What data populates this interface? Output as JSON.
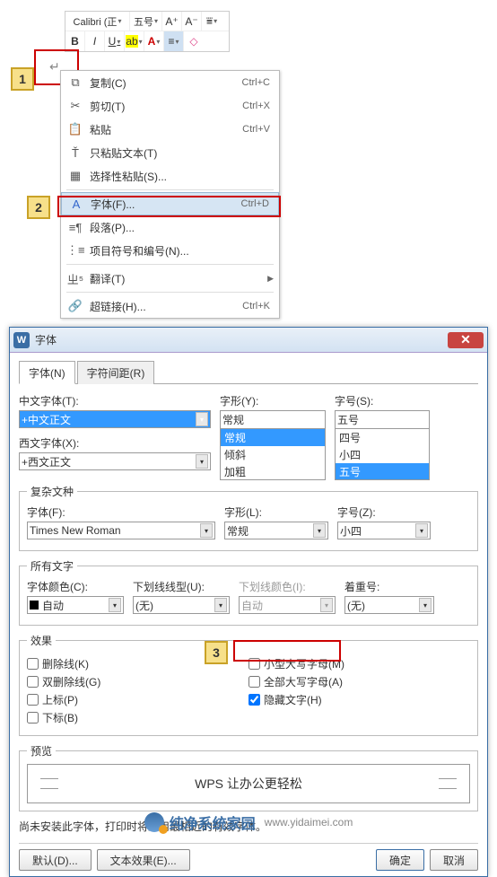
{
  "mini_toolbar": {
    "font_name": "Calibri (正",
    "font_size": "五号",
    "btn_inc": "A⁺",
    "btn_dec": "A⁻",
    "btn_linespace": "⩸",
    "b": "B",
    "i": "I",
    "u": "U",
    "hl": "ab",
    "color": "A",
    "align": "≡",
    "eraser": "◇"
  },
  "context_menu": {
    "items": [
      {
        "icon": "⧉",
        "label": "复制(C)",
        "shortcut": "Ctrl+C"
      },
      {
        "icon": "✂",
        "label": "剪切(T)",
        "shortcut": "Ctrl+X"
      },
      {
        "icon": "📋",
        "label": "粘贴",
        "shortcut": "Ctrl+V"
      },
      {
        "icon": "Ť",
        "label": "只粘贴文本(T)",
        "shortcut": ""
      },
      {
        "icon": "▦",
        "label": "选择性粘贴(S)...",
        "shortcut": ""
      },
      {
        "icon": "A",
        "label": "字体(F)...",
        "shortcut": "Ctrl+D",
        "hl": true
      },
      {
        "icon": "≡¶",
        "label": "段落(P)...",
        "shortcut": ""
      },
      {
        "icon": "⋮≡",
        "label": "项目符号和编号(N)...",
        "shortcut": ""
      },
      {
        "icon": "ㄓ⁵",
        "label": "翻译(T)",
        "shortcut": "",
        "submenu": true
      },
      {
        "icon": "🔗",
        "label": "超链接(H)...",
        "shortcut": "Ctrl+K"
      }
    ]
  },
  "dialog": {
    "title": "字体",
    "tabs": {
      "font": "字体(N)",
      "spacing": "字符间距(R)"
    },
    "labels": {
      "cn_font": "中文字体(T):",
      "en_font": "西文字体(X):",
      "style": "字形(Y):",
      "size": "字号(S):",
      "complex_section": "复杂文种",
      "complex_font": "字体(F):",
      "complex_style": "字形(L):",
      "complex_size": "字号(Z):",
      "all_text": "所有文字",
      "font_color": "字体颜色(C):",
      "underline": "下划线线型(U):",
      "underline_color": "下划线颜色(I):",
      "emphasis": "着重号:",
      "effects": "效果",
      "preview": "预览"
    },
    "values": {
      "cn_font_val": "+中文正文",
      "en_font_val": "+西文正文",
      "style_val": "常规",
      "style_opts": [
        "常规",
        "倾斜",
        "加粗"
      ],
      "size_val": "五号",
      "size_opts": [
        "四号",
        "小四",
        "五号"
      ],
      "complex_font_val": "Times New Roman",
      "complex_style_val": "常规",
      "complex_size_val": "小四",
      "font_color_val": "自动",
      "underline_val": "(无)",
      "underline_color_val": "自动",
      "emphasis_val": "(无)"
    },
    "effects": {
      "strike": "删除线(K)",
      "dstrike": "双删除线(G)",
      "sup": "上标(P)",
      "sub": "下标(B)",
      "smallcaps": "小型大写字母(M)",
      "allcaps": "全部大写字母(A)",
      "hidden": "隐藏文字(H)"
    },
    "preview_text": "WPS 让办公更轻松",
    "note": "尚未安装此字体，打印时将采用最相近的有效字体。",
    "buttons": {
      "default": "默认(D)...",
      "text_effects": "文本效果(E)...",
      "ok": "确定",
      "cancel": "取消"
    }
  },
  "callouts": {
    "c1": "1",
    "c2": "2",
    "c3": "3"
  },
  "footer": {
    "brand": "纯净系统家园",
    "url": "www.yidaimei.com"
  }
}
